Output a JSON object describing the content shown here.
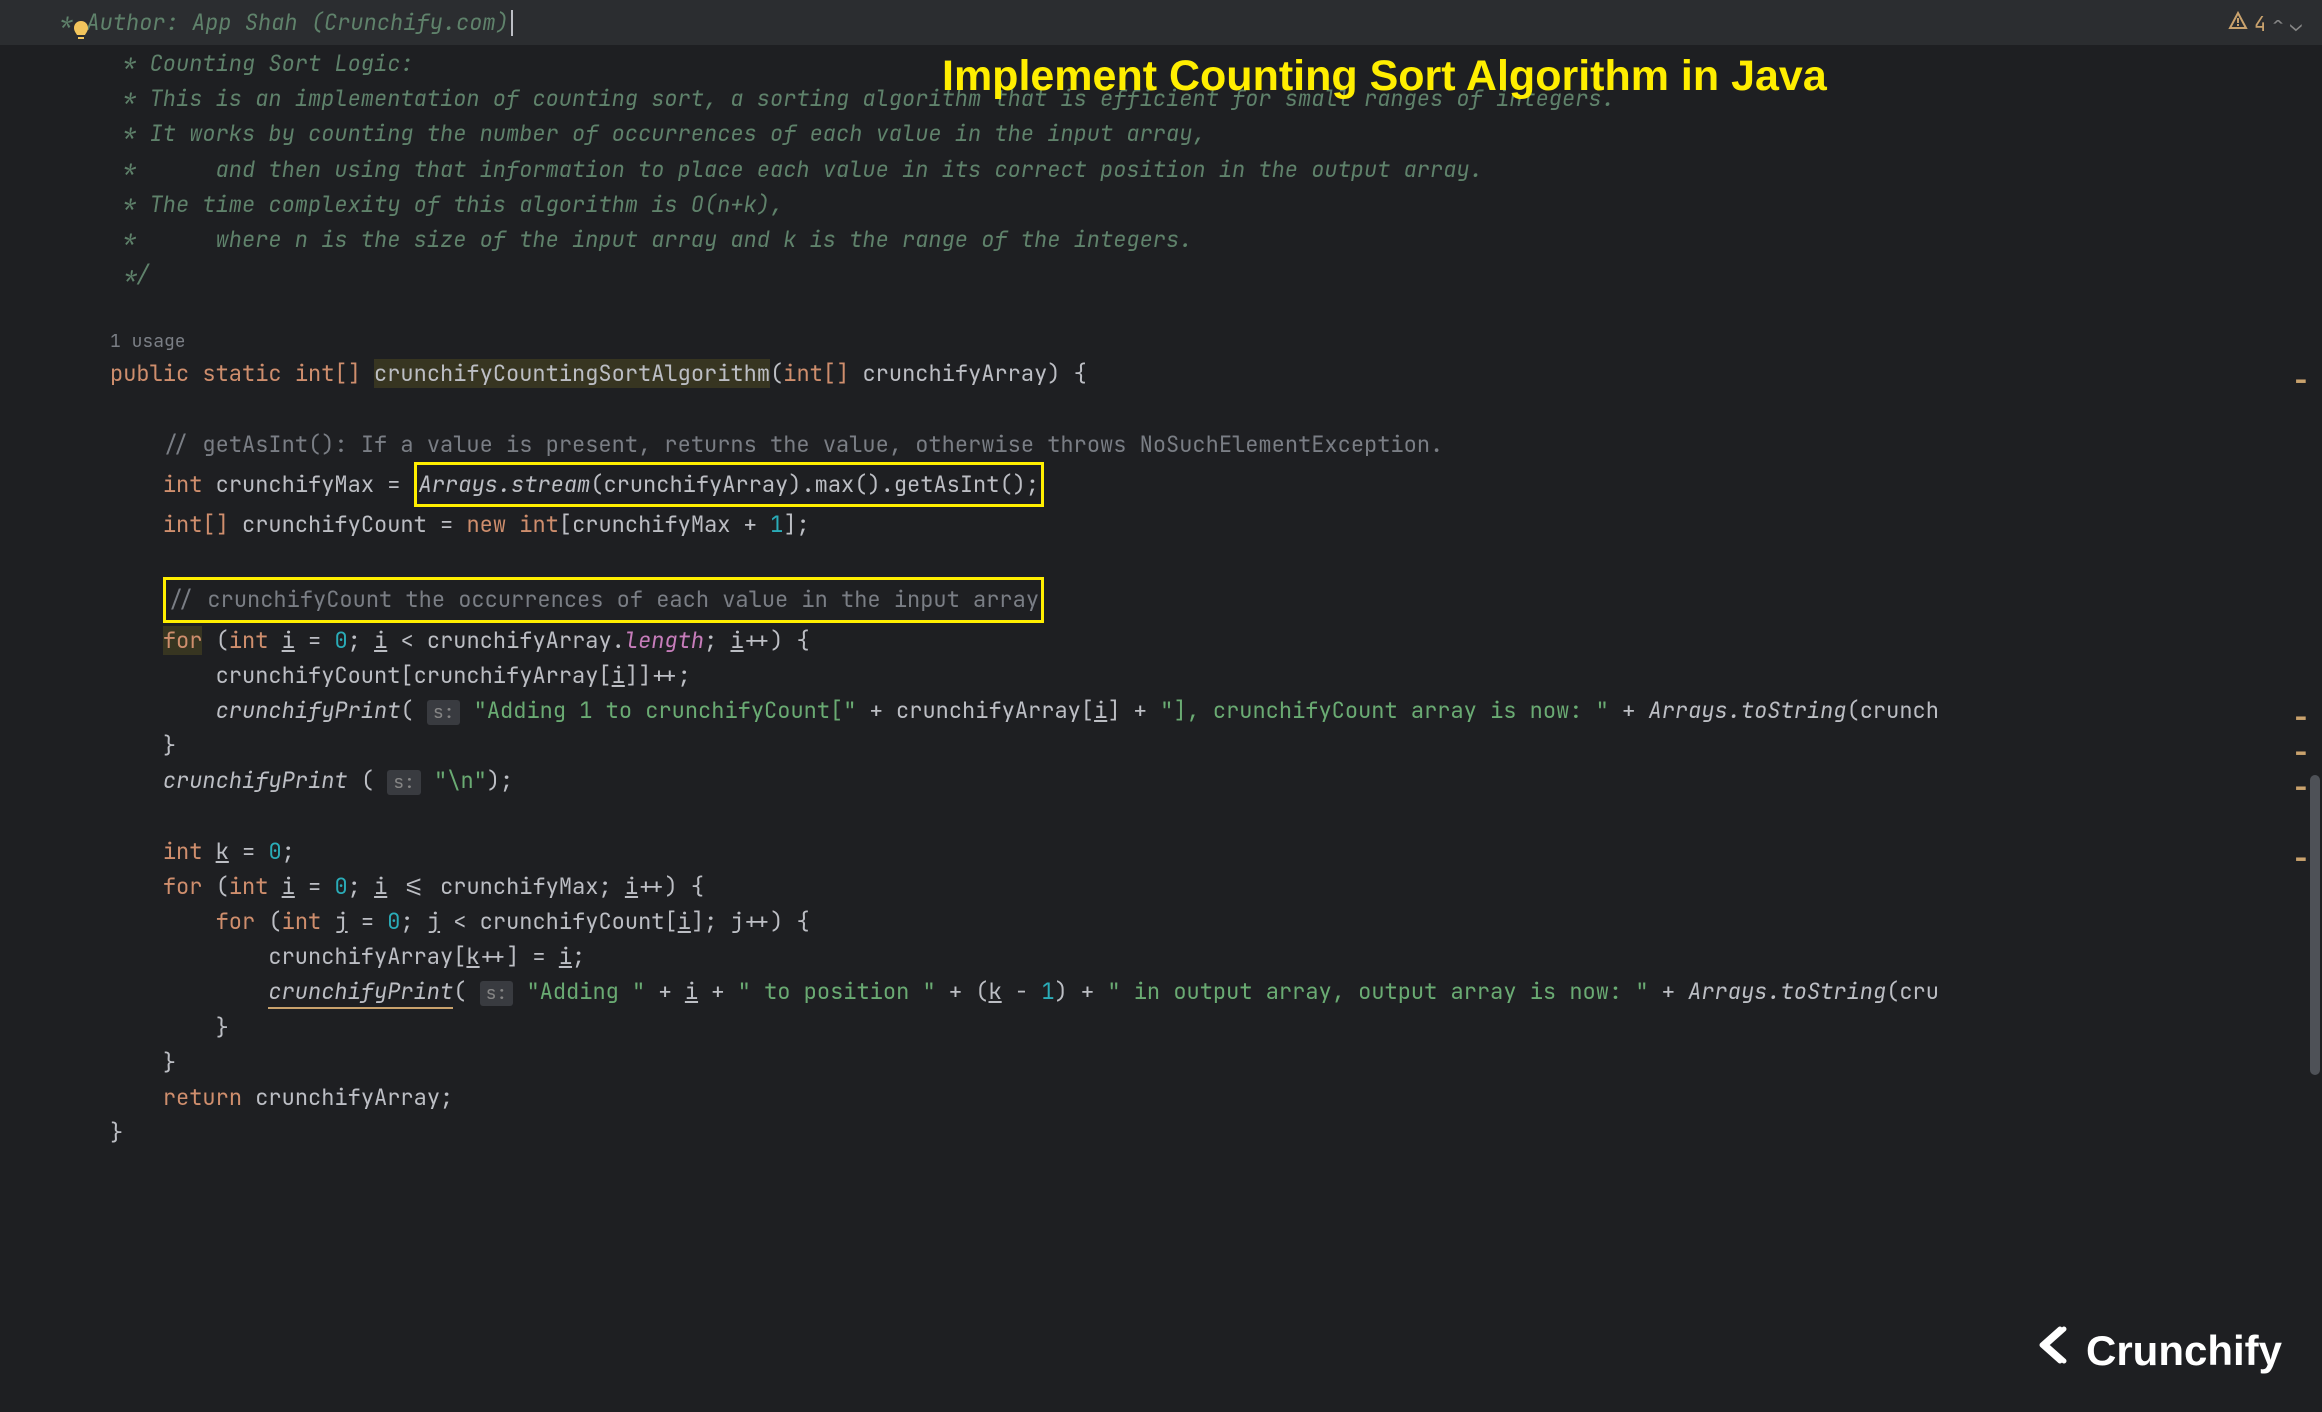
{
  "warnings": {
    "count": "4"
  },
  "title": "Implement Counting Sort Algorithm in Java",
  "topBar": " * Author: App Shah (Crunchify.com)",
  "comments": {
    "l1": " * Counting Sort Logic:",
    "l2": " * This is an implementation of counting sort, a sorting algorithm that is efficient for small ranges of integers.",
    "l3": " * It works by counting the number of occurrences of each value in the input array,",
    "l4": " *      and then using that information to place each value in its correct position in the output array.",
    "l5": " * The time complexity of this algorithm is O(n+k),",
    "l6": " *      where n is the size of the input array and k is the range of the integers.",
    "l7": " */"
  },
  "usage": "1 usage",
  "code": {
    "public": "public",
    "static": "static",
    "intArr": "int[]",
    "int": "int",
    "methodName": "crunchifyCountingSortAlgorithm",
    "param": "crunchifyArray",
    "brace": ") {",
    "comment1": "// getAsInt(): If a value is present, returns the value, otherwise throws NoSuchElementException.",
    "maxVar": "crunchifyMax",
    "equals": " = ",
    "arraysStream": "Arrays.stream(crunchifyArray).max().getAsInt();",
    "arraysClass": "Arrays",
    "stream": ".stream",
    "maxCall": "(crunchifyArray).max().getAsInt();",
    "countVar": "crunchifyCount",
    "newKw": "new",
    "newInt": "int",
    "bracket1": "[crunchifyMax + ",
    "one": "1",
    "bracket2": "];",
    "comment2": "// crunchifyCount the occurrences of each value in the input array",
    "for": "for",
    "loopInit1": " (",
    "i": "i",
    "zero": "0",
    "semicolon": "; ",
    "lt": " < crunchifyArray.",
    "length": "length",
    "incI": "++) {",
    "countInc": "crunchifyCount[crunchifyArray[",
    "iVar": "i",
    "countInc2": "]]++;",
    "printCall": "crunchifyPrint",
    "paramS": "s:",
    "str1": "\"Adding 1 to crunchifyCount[\"",
    "plus": " + crunchifyArray[",
    "str2": "\"], crunchifyCount array is now: \"",
    "toString": "toString",
    "crunchP": "(crunch",
    "closeBrace": "}",
    "newline": "\"\\n\"",
    "kVar": "k",
    "lteMax": " <= crunchifyMax; ",
    "jVar": "j",
    "ltCount": " < crunchifyCount[",
    "jInc": "]; j++) {",
    "arrayAssign": "crunchifyArray[",
    "kInc": "++] = ",
    "semi": ";",
    "str3": "\"Adding \"",
    "str4": "\" to position \"",
    "kMinus": " + (",
    "minus1": " - ",
    "str5": ") + ",
    "str6": "\" in output array, output array is now: \"",
    "crP": "(cru",
    "return": "return",
    "retVal": " crunchifyArray;"
  },
  "logo": "Crunchify"
}
